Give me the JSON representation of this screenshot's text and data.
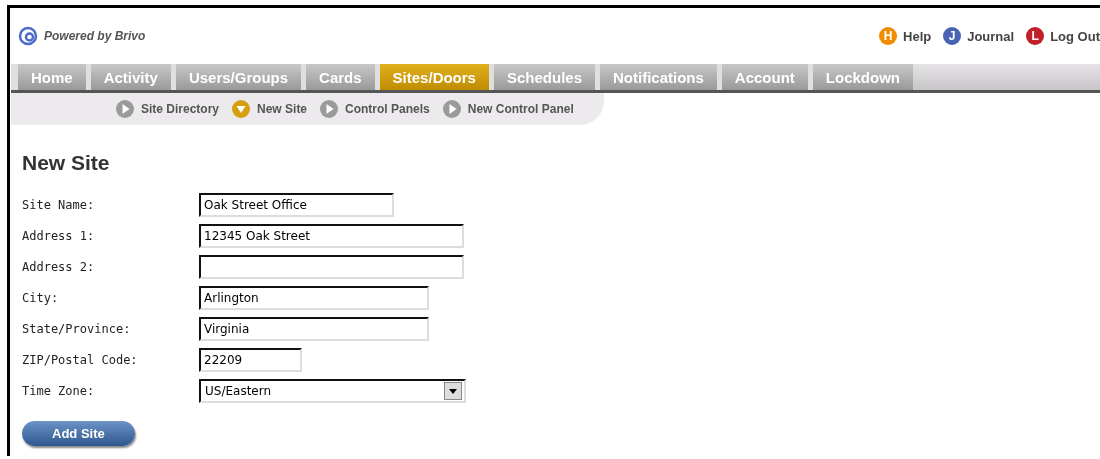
{
  "brand": {
    "text": "Powered by Brivo"
  },
  "top_links": [
    {
      "letter": "H",
      "label": "Help",
      "color": "#f08c00"
    },
    {
      "letter": "J",
      "label": "Journal",
      "color": "#4a64b4"
    },
    {
      "letter": "L",
      "label": "Log Out",
      "color": "#c0202a"
    }
  ],
  "tabs": [
    {
      "label": "Home",
      "selected": false
    },
    {
      "label": "Activity",
      "selected": false
    },
    {
      "label": "Users/Groups",
      "selected": false
    },
    {
      "label": "Cards",
      "selected": false
    },
    {
      "label": "Sites/Doors",
      "selected": true
    },
    {
      "label": "Schedules",
      "selected": false
    },
    {
      "label": "Notifications",
      "selected": false
    },
    {
      "label": "Account",
      "selected": false
    },
    {
      "label": "Lockdown",
      "selected": false
    }
  ],
  "subnav": [
    {
      "label": "Site Directory",
      "selected": false
    },
    {
      "label": "New Site",
      "selected": true
    },
    {
      "label": "Control Panels",
      "selected": false
    },
    {
      "label": "New Control Panel",
      "selected": false
    }
  ],
  "heading": "New Site",
  "fields": [
    {
      "label": "Site Name:",
      "kind": "text",
      "value": "Oak Street Office"
    },
    {
      "label": "Address 1:",
      "kind": "text",
      "value": "12345 Oak Street"
    },
    {
      "label": "Address 2:",
      "kind": "text"
    },
    {
      "label": "City:",
      "kind": "text",
      "value": "Arlington"
    },
    {
      "label": "State/Province:",
      "kind": "text",
      "value": "Virginia"
    },
    {
      "label": "ZIP/Postal Code:",
      "kind": "text",
      "value": "22209"
    },
    {
      "label": "Time Zone:",
      "kind": "select",
      "value": "US/Eastern"
    }
  ],
  "submit": {
    "label": "Add Site"
  }
}
